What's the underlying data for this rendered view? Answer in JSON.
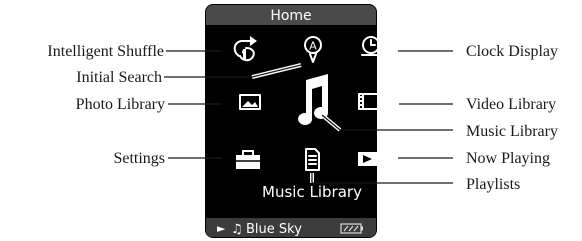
{
  "device": {
    "header_title": "Home",
    "selected_caption": "Music Library",
    "now_playing": {
      "arrow_glyph": "►",
      "note_glyph": "♫",
      "track": "Blue Sky"
    }
  },
  "labels": {
    "intelligent_shuffle": "Intelligent Shuffle",
    "initial_search": "Initial Search",
    "photo_library": "Photo Library",
    "settings": "Settings",
    "clock_display": "Clock Display",
    "video_library": "Video Library",
    "music_library": "Music Library",
    "now_playing": "Now Playing",
    "playlists": "Playlists"
  },
  "icons": [
    "shuffle-icon",
    "initial-search-icon",
    "clock-icon",
    "photo-icon",
    "music-note-icon",
    "video-icon",
    "settings-icon",
    "playlist-icon",
    "now-playing-icon",
    "battery-icon"
  ],
  "colors": {
    "screen_bg": "#000000",
    "header_bg": "#4a4a4a",
    "footer_bg": "#3c3c3c",
    "icon": "#ffffff",
    "text": "#1a1a1a"
  }
}
